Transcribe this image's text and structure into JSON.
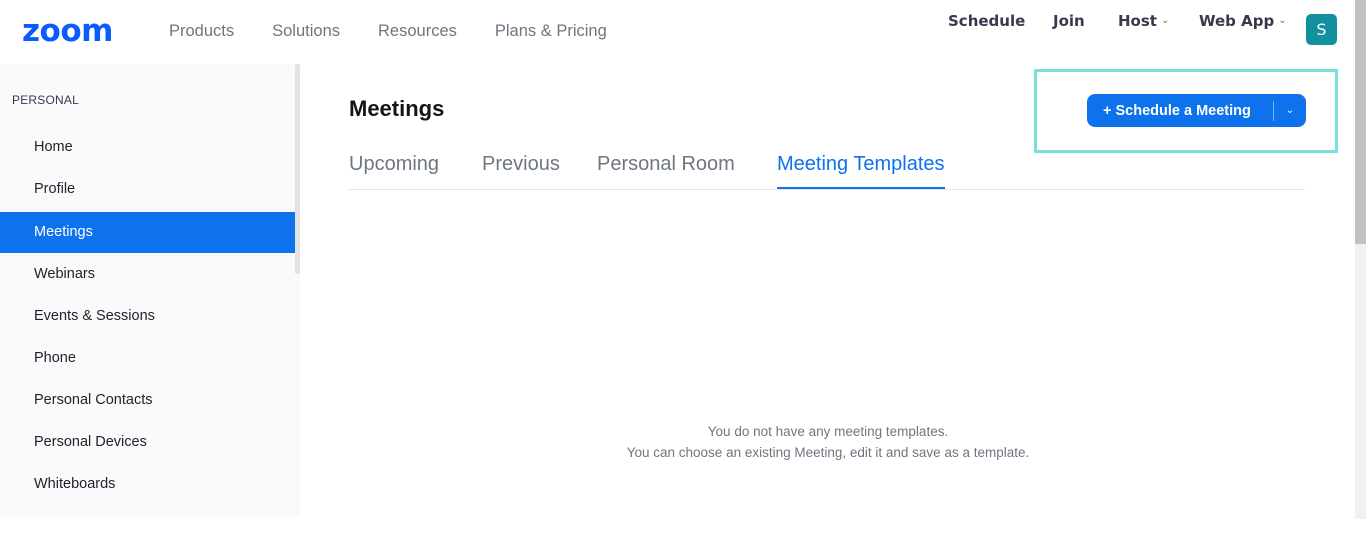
{
  "header": {
    "logo": "zoom",
    "nav_left": [
      "Products",
      "Solutions",
      "Resources",
      "Plans & Pricing"
    ],
    "nav_right": {
      "schedule": "Schedule",
      "join": "Join",
      "host": "Host",
      "web_app": "Web App"
    },
    "avatar_initial": "S"
  },
  "sidebar": {
    "section": "PERSONAL",
    "items": [
      {
        "label": "Home"
      },
      {
        "label": "Profile"
      },
      {
        "label": "Meetings",
        "active": true
      },
      {
        "label": "Webinars"
      },
      {
        "label": "Events & Sessions"
      },
      {
        "label": "Phone"
      },
      {
        "label": "Personal Contacts"
      },
      {
        "label": "Personal Devices"
      },
      {
        "label": "Whiteboards"
      }
    ]
  },
  "main": {
    "title": "Meetings",
    "tabs": [
      {
        "label": "Upcoming"
      },
      {
        "label": "Previous"
      },
      {
        "label": "Personal Room"
      },
      {
        "label": "Meeting Templates",
        "active": true
      }
    ],
    "schedule_button": "+ Schedule a Meeting",
    "empty_line1": "You do not have any meeting templates.",
    "empty_line2": "You can choose an existing Meeting, edit it and save as a template."
  },
  "colors": {
    "brand": "#0b5cff",
    "accent": "#0e72ed",
    "avatar": "#13909e",
    "highlight": "#78e0dc"
  }
}
